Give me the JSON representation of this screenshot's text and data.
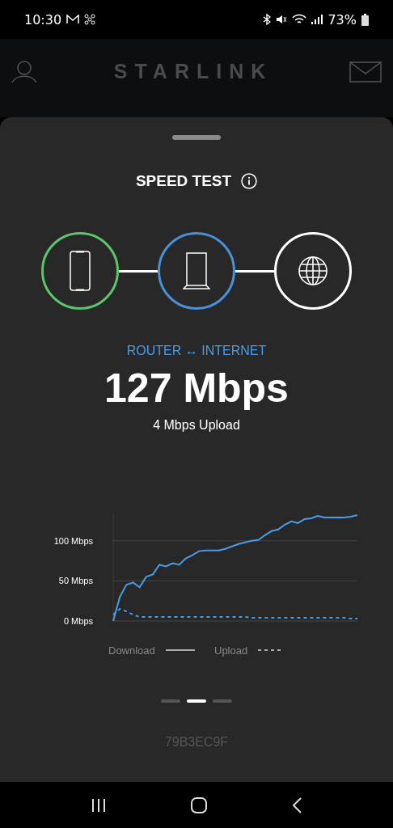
{
  "status_bar": {
    "time": "10:30",
    "battery": "73%"
  },
  "header": {
    "title": "STARLINK"
  },
  "sheet": {
    "title": "SPEED TEST",
    "nodes": [
      {
        "kind": "phone",
        "color": "#5cc46a"
      },
      {
        "kind": "router",
        "color": "#4a90d9"
      },
      {
        "kind": "globe",
        "color": "#ffffff"
      }
    ],
    "segment": "ROUTER ↔ INTERNET",
    "speed": "127 Mbps",
    "upload": "4 Mbps Upload",
    "chart_data": {
      "type": "line",
      "ylim": [
        0,
        135
      ],
      "yticks": [
        {
          "value": 0,
          "label": "0 Mbps"
        },
        {
          "value": 50,
          "label": "50 Mbps"
        },
        {
          "value": 100,
          "label": "100 Mbps"
        }
      ],
      "series": [
        {
          "name": "Download",
          "color": "#4a9be8",
          "line_style": "solid",
          "values": [
            0,
            30,
            45,
            48,
            42,
            55,
            58,
            70,
            68,
            72,
            70,
            78,
            82,
            87,
            88,
            88,
            88,
            90,
            93,
            96,
            98,
            100,
            101,
            107,
            112,
            114,
            120,
            124,
            122,
            127,
            128,
            131,
            129,
            129,
            129,
            129,
            130,
            132
          ]
        },
        {
          "name": "Upload",
          "color": "#4a9be8",
          "line_style": "dashed",
          "values": [
            8,
            15,
            12,
            8,
            5,
            5,
            5,
            5,
            5,
            5,
            5,
            5,
            5,
            5,
            5,
            5,
            5,
            5,
            5,
            5,
            5,
            4,
            4,
            4,
            4,
            4,
            4,
            4,
            4,
            4,
            4,
            4,
            4,
            4,
            4,
            4,
            3,
            3
          ]
        }
      ]
    },
    "pages": [
      {
        "selected": false
      },
      {
        "selected": true
      },
      {
        "selected": false
      }
    ],
    "device_id": "79B3EC9F"
  }
}
